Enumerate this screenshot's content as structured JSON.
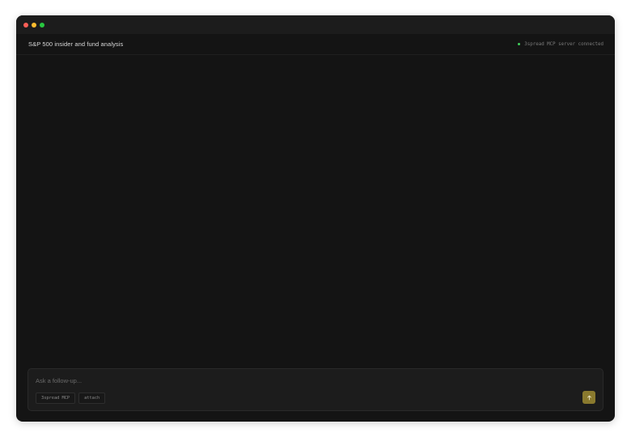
{
  "conversation": {
    "title": "S&P 500 insider and fund analysis"
  },
  "status": {
    "text": "3spread MCP server connected",
    "color": "#3fcf5a"
  },
  "composer": {
    "placeholder": "Ask a follow-up...",
    "chips": [
      {
        "label": "3spread MCP"
      },
      {
        "label": "attach"
      }
    ],
    "send_icon": "arrow-up-icon",
    "send_color": "#8a7a2e"
  },
  "window_controls": [
    "close",
    "minimize",
    "zoom"
  ]
}
